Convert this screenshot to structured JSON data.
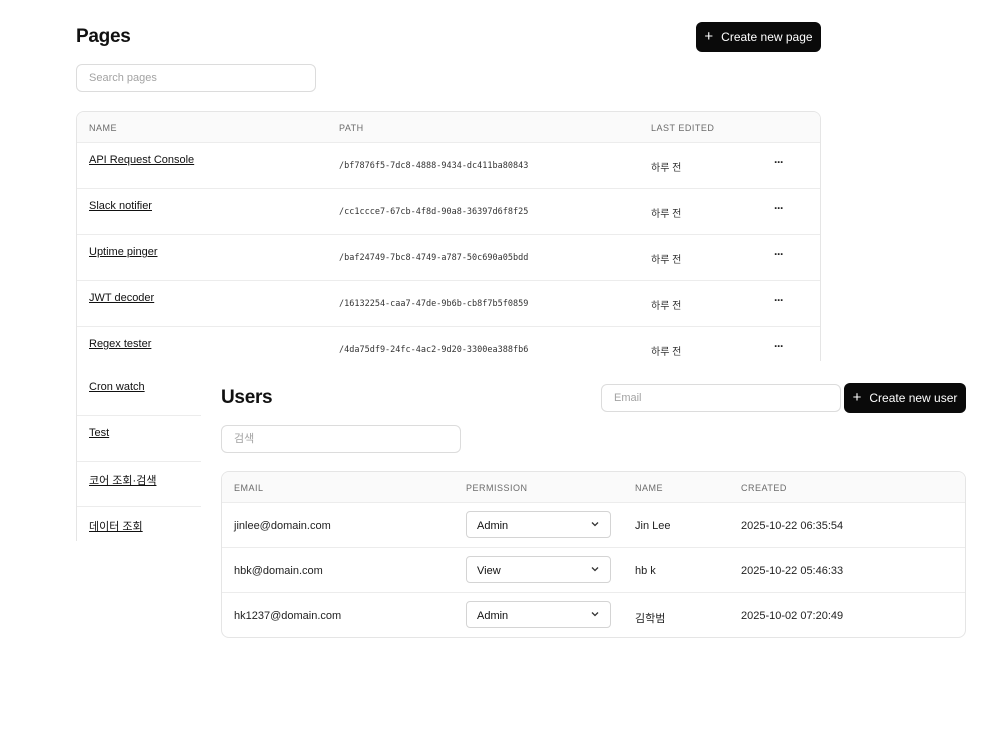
{
  "pages": {
    "title": "Pages",
    "create_button": {
      "icon": "plus-icon",
      "label": "Create new page"
    },
    "search_placeholder": "Search pages",
    "columns": {
      "name": "NAME",
      "path": "PATH",
      "last_edited": "LAST EDITED"
    },
    "rows": [
      {
        "name": "API Request Console",
        "path": "/bf7876f5-7dc8-4888-9434-dc411ba80843",
        "last_edited": "하루 전",
        "more": "···"
      },
      {
        "name": "Slack notifier",
        "path": "/cc1ccce7-67cb-4f8d-90a8-36397d6f8f25",
        "last_edited": "하루 전",
        "more": "···"
      },
      {
        "name": "Uptime pinger",
        "path": "/baf24749-7bc8-4749-a787-50c690a05bdd",
        "last_edited": "하루 전",
        "more": "···"
      },
      {
        "name": "JWT decoder",
        "path": "/16132254-caa7-47de-9b6b-cb8f7b5f0859",
        "last_edited": "하루 전",
        "more": "···"
      },
      {
        "name": "Regex tester",
        "path": "/4da75df9-24fc-4ac2-9d20-3300ea388fb6",
        "last_edited": "하루 전",
        "more": "···"
      },
      {
        "name": "Cron watch"
      },
      {
        "name": "Test"
      },
      {
        "name": "코어 조회·검색"
      },
      {
        "name": "데이터 조회"
      }
    ]
  },
  "users": {
    "title": "Users",
    "email_placeholder": "Email",
    "create_button": {
      "icon": "plus-icon",
      "label": "Create new user"
    },
    "search_placeholder": "검색",
    "columns": {
      "email": "EMAIL",
      "permission": "PERMISSION",
      "name": "NAME",
      "created": "CREATED"
    },
    "rows": [
      {
        "email": "jinlee@domain.com",
        "permission": "Admin",
        "name": "Jin Lee",
        "created": "2025-10-22 06:35:54"
      },
      {
        "email": "hbk@domain.com",
        "permission": "View",
        "name": "hb k",
        "created": "2025-10-22 05:46:33"
      },
      {
        "email": "hk1237@domain.com",
        "permission": "Admin",
        "name": "김학범",
        "created": "2025-10-02 07:20:49"
      }
    ]
  },
  "colors": {
    "button_bg": "#0a0a0a",
    "button_text": "#ffffff",
    "border": "#e5e5e5",
    "header_bg": "#fafafa"
  }
}
